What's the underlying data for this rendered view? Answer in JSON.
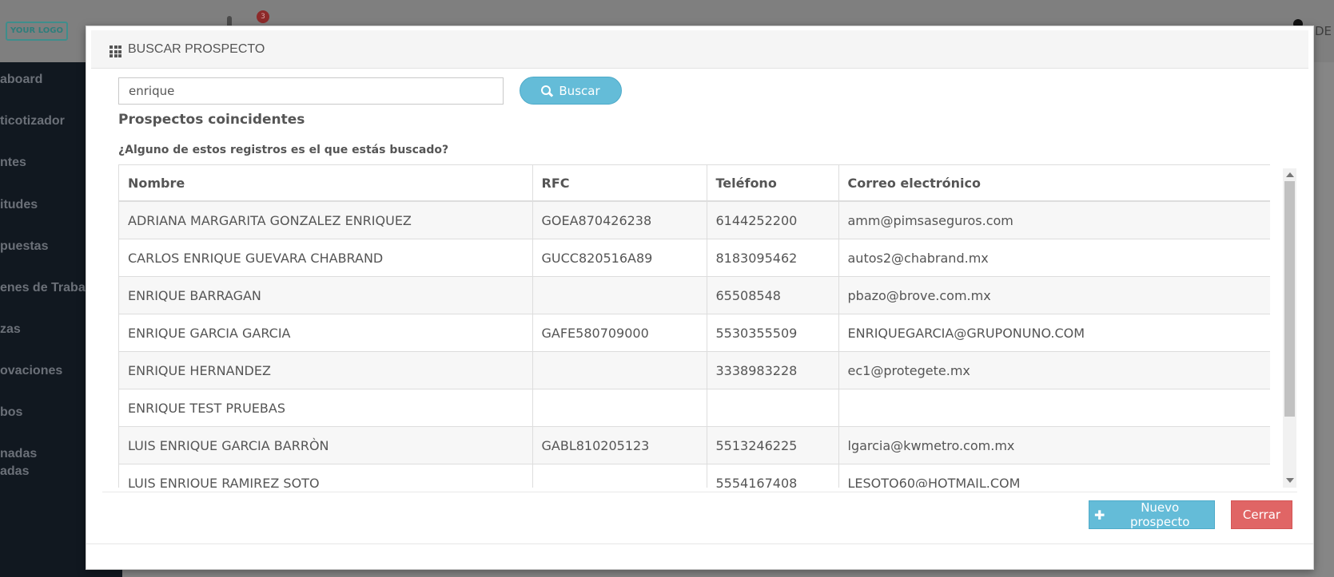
{
  "app": {
    "logo_text": "YOUR LOGO",
    "notification_count": "3",
    "user_name": "DE",
    "sidebar": [
      "aboard",
      "ticotizador",
      "ntes",
      "itudes",
      "puestas",
      "enes de Traba",
      "zas",
      "ovaciones",
      "bos",
      "nadas",
      "adas"
    ]
  },
  "modal": {
    "title": "BUSCAR PROSPECTO",
    "search": {
      "value": "enrique"
    },
    "search_button": "Buscar",
    "section_title": "Prospectos coincidentes",
    "question": "¿Alguno de estos registros es el que estás buscado?",
    "table": {
      "headers": [
        "Nombre",
        "RFC",
        "Teléfono",
        "Correo electrónico"
      ],
      "rows": [
        [
          "ADRIANA MARGARITA GONZALEZ ENRIQUEZ",
          "GOEA870426238",
          "6144252200",
          "amm@pimsaseguros.com"
        ],
        [
          "CARLOS ENRIQUE GUEVARA CHABRAND",
          "GUCC820516A89",
          "8183095462",
          "autos2@chabrand.mx"
        ],
        [
          "ENRIQUE BARRAGAN",
          "",
          "65508548",
          "pbazo@brove.com.mx"
        ],
        [
          "ENRIQUE GARCIA GARCIA",
          "GAFE580709000",
          "5530355509",
          "ENRIQUEGARCIA@GRUPONUNO.COM"
        ],
        [
          "ENRIQUE HERNANDEZ",
          "",
          "3338983228",
          "ec1@protegete.mx"
        ],
        [
          "ENRIQUE TEST PRUEBAS",
          "",
          "",
          ""
        ],
        [
          "LUIS ENRIQUE GARCIA BARRÒN",
          "GABL810205123",
          "5513246225",
          "lgarcia@kwmetro.com.mx"
        ],
        [
          "LUIS ENRIQUE RAMIREZ SOTO",
          "",
          "5554167408",
          "LESOTO60@HOTMAIL.COM"
        ]
      ]
    },
    "buttons": {
      "new_prospect": "Nuevo prospecto",
      "close": "Cerrar"
    }
  }
}
